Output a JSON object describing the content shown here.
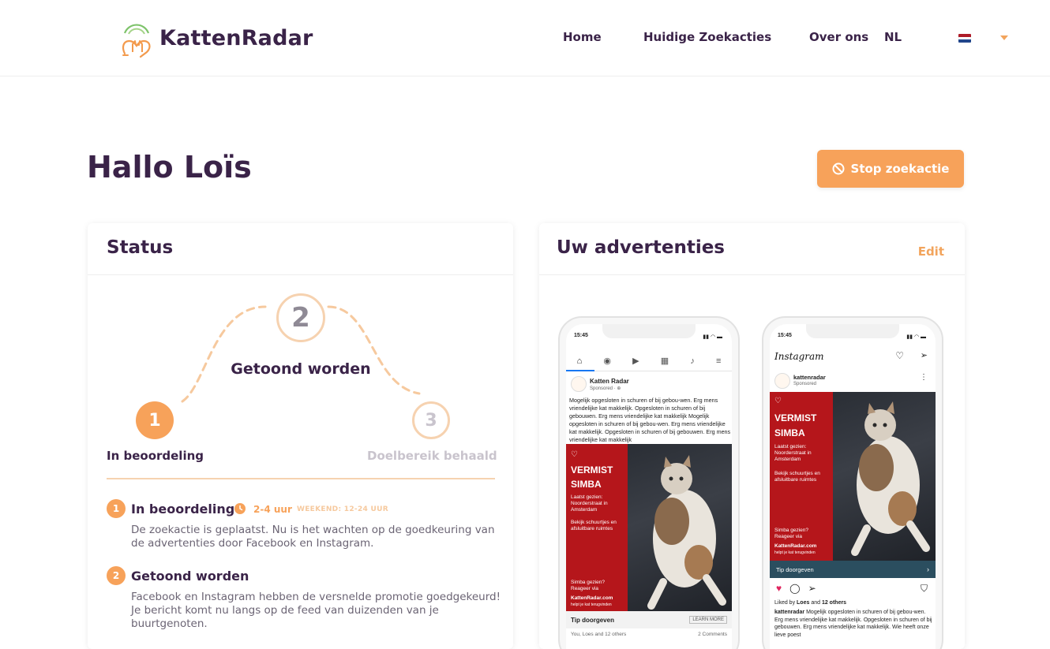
{
  "header": {
    "brand": "KattenRadar",
    "nav": [
      "Home",
      "Huidige Zoekacties",
      "Over ons"
    ],
    "language": "NL",
    "flag_colors": [
      "#ae1c28",
      "#ffffff",
      "#21468b"
    ]
  },
  "page": {
    "greeting": "Hallo Loïs",
    "stop_button": "Stop zoekactie"
  },
  "status_card": {
    "title": "Status",
    "steps": [
      {
        "number": "1",
        "label": "In beoordeling",
        "state": "active"
      },
      {
        "number": "2",
        "label": "Getoond worden",
        "state": "pending"
      },
      {
        "number": "3",
        "label": "Doelbereik behaald",
        "state": "pending"
      }
    ],
    "details": [
      {
        "number": "1",
        "title": "In beoordeling",
        "time": "2-4 uur",
        "weekend": "WEEKEND: 12-24 UUR",
        "text": "De zoekactie is geplaatst. Nu is het wachten op de goedkeuring van de advertenties door Facebook en Instagram."
      },
      {
        "number": "2",
        "title": "Getoond worden",
        "text": "Facebook en Instagram hebben de versnelde promotie goedgekeurd! Je bericht komt nu langs op de feed van duizenden van je buurtgenoten."
      }
    ]
  },
  "ads_card": {
    "title": "Uw advertenties",
    "edit": "Edit",
    "facebook": {
      "time": "15:45",
      "page": "Katten Radar",
      "sponsored": "Sponsored · ⊕",
      "body": "Mogelijk opgesloten in schuren of bij  gebou-wen. Erg mens vriendelijke kat makkelijk. Opgesloten in schuren of bij gebouwen. Erg mens vriendelijke kat makkelijk Mogelijk opgesloten in schuren of bij  gebou-wen. Erg mens vriendelijke kat makkelijk. Opgesloten in schuren of bij gebouwen. Erg mens vriendelijke kat makkelijk",
      "ad_title_1": "VERMIST",
      "ad_title_2": "SIMBA",
      "ad_seen": "Laatst gezien: Noorderstraat in Amsterdam",
      "ad_check": "Bekijk schuurtjes en afsluitbare ruimtes",
      "ad_seen_q": "Simba gezien? Reageer via",
      "ad_site": "KattenRadar.com",
      "ad_tagline": "helpt je kat terugvinden",
      "cta": "Tip doorgeven",
      "learn_more": "LEARN MORE",
      "reactions": "You, Loes and 12 others",
      "comments": "2 Comments"
    },
    "instagram": {
      "time": "15:45",
      "app": "Instagram",
      "account": "kattenradar",
      "sponsored": "Sponsored",
      "cta": "Tip doorgeven",
      "liked_prefix": "Liked by ",
      "liked_name": "Loes",
      "liked_middle": " and ",
      "liked_count": "12 others",
      "caption_user": "kattenradar",
      "caption": "Mogelijk opgesloten in schuren of bij gebou-wen. Erg mens vriendelijke kat makkelijk. Opgesloten in schuren of bij gebouwen. Erg mens vriendelijke kat makkelijk. Wie heeft onze lieve poest"
    }
  },
  "colors": {
    "brand_dark": "#3a2348",
    "accent_orange": "#f7a25a",
    "ad_red": "#b5161b"
  }
}
